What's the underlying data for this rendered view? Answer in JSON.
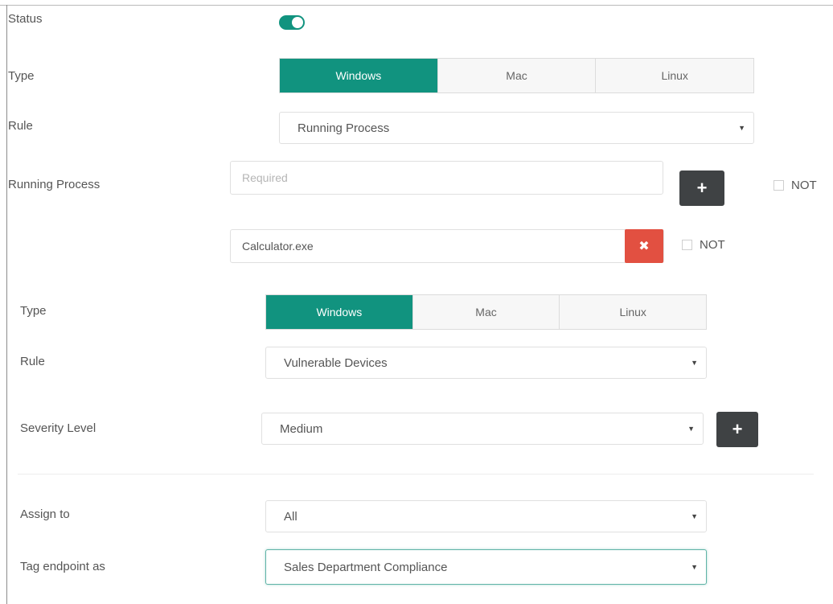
{
  "status": {
    "label": "Status",
    "enabled": true
  },
  "primary": {
    "type": {
      "label": "Type",
      "options": [
        "Windows",
        "Mac",
        "Linux"
      ],
      "selected": "Windows"
    },
    "rule": {
      "label": "Rule",
      "value": "Running Process"
    },
    "running_process": {
      "label": "Running Process",
      "placeholder": "Required",
      "add_icon": "plus-icon",
      "not_label": "NOT",
      "entry_value": "Calculator.exe",
      "remove_icon": "close-icon",
      "entry_not_label": "NOT"
    }
  },
  "secondary": {
    "type": {
      "label": "Type",
      "options": [
        "Windows",
        "Mac",
        "Linux"
      ],
      "selected": "Windows"
    },
    "rule": {
      "label": "Rule",
      "value": "Vulnerable Devices"
    },
    "severity": {
      "label": "Severity Level",
      "value": "Medium",
      "add_icon": "plus-icon"
    }
  },
  "assign": {
    "label": "Assign to",
    "value": "All"
  },
  "tag": {
    "label": "Tag endpoint as",
    "value": "Sales Department Compliance"
  },
  "colors": {
    "accent": "#11937f",
    "danger": "#e25041",
    "dark_button": "#3f4244"
  },
  "icons": {
    "caret": "caret-down-icon"
  }
}
